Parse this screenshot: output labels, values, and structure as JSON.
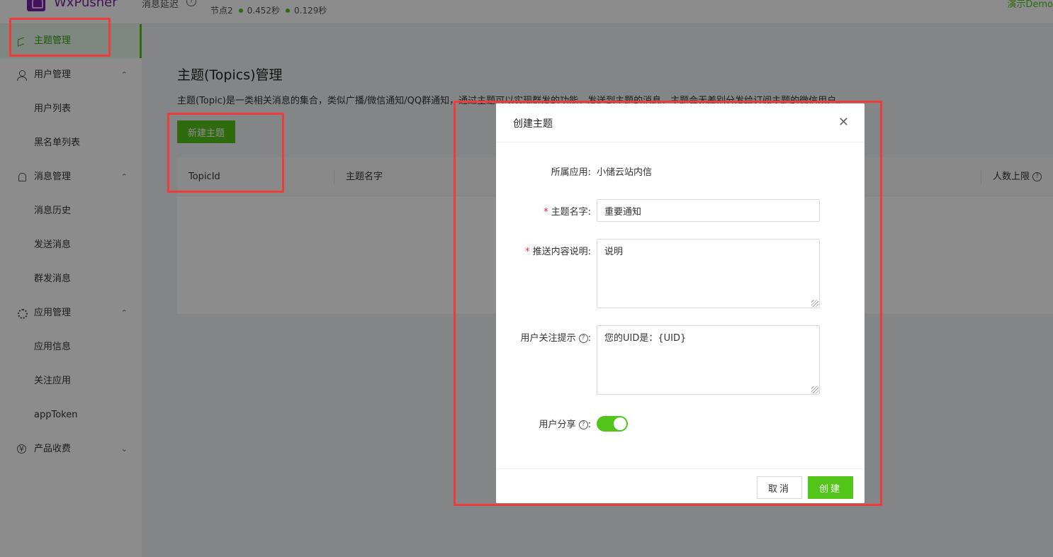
{
  "header": {
    "logo_text": "WxPusher",
    "latency_label": "消息延迟",
    "latency_help": "?",
    "node_label": "节点2",
    "node_latency_1": "0.452秒",
    "node_latency_2": "0.129秒",
    "demo_user": "演示Demo"
  },
  "sidebar": {
    "items": [
      {
        "label": "主题管理",
        "icon": "flag-icon",
        "active": true
      },
      {
        "label": "用户管理",
        "icon": "user-icon",
        "arrow": "⌃"
      },
      {
        "label": "用户列表"
      },
      {
        "label": "黑名单列表"
      },
      {
        "label": "消息管理",
        "icon": "bell-icon",
        "arrow": "⌃"
      },
      {
        "label": "消息历史"
      },
      {
        "label": "发送消息"
      },
      {
        "label": "群发消息"
      },
      {
        "label": "应用管理",
        "icon": "gear-icon",
        "arrow": "⌃"
      },
      {
        "label": "应用信息"
      },
      {
        "label": "关注应用"
      },
      {
        "label": "appToken"
      },
      {
        "label": "产品收费",
        "icon": "yen-icon",
        "icon_glyph": "¥",
        "arrow": "⌄"
      }
    ]
  },
  "main": {
    "title": "主题(Topics)管理",
    "description": "主题(Topic)是一类相关消息的集合，类似广播/微信通知/QQ群通知，通过主题可以实现群发的功能，发送到主题的消息，主题会无差别分发给订阅主题的微信用户。",
    "new_topic_label": "新建主题",
    "table": {
      "columns": [
        "TopicId",
        "主题名字",
        "人数上限"
      ],
      "help": "?"
    }
  },
  "modal": {
    "title": "创建主题",
    "close": "✕",
    "app_label": "所属应用:",
    "app_value": "小储云站内信",
    "topic_name_label": "主题名字:",
    "topic_name_value": "重要通知",
    "push_desc_label": "推送内容说明:",
    "push_desc_value": "说明",
    "follow_tip_label": "用户关注提示",
    "follow_tip_value": "您的UID是：{UID}",
    "share_label": "用户分享",
    "share_on": true,
    "colon": ":",
    "help": "?",
    "required_mark": "*",
    "cancel_label": "取消",
    "create_label": "创建"
  },
  "colors": {
    "primary": "#52c41a",
    "brand": "#7b1fa2",
    "annotation": "#ee3b3b",
    "required": "#f5222d"
  }
}
